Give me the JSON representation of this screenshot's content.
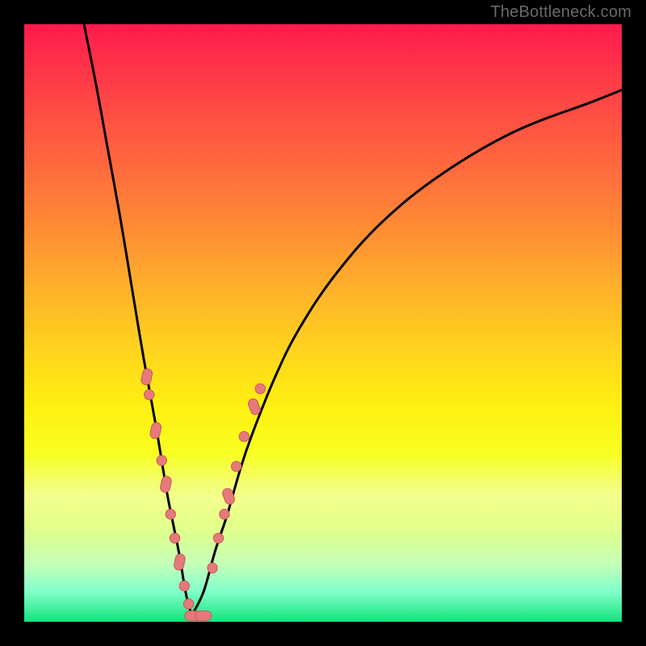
{
  "watermark": {
    "text": "TheBottleneck.com"
  },
  "colors": {
    "page_bg": "#000000",
    "curve_stroke": "#000000",
    "marker_fill": "#e67a7a",
    "marker_stroke": "#c85a5a"
  },
  "chart_data": {
    "type": "line",
    "title": "",
    "xlabel": "",
    "ylabel": "",
    "xlim": [
      0,
      100
    ],
    "ylim": [
      0,
      100
    ],
    "note": "Values are relative coordinates (percent of plot area). Two branches meet near bottom at x≈28.",
    "series": [
      {
        "name": "left-branch",
        "x": [
          10,
          12,
          14,
          16,
          18,
          20,
          22,
          23,
          24,
          25,
          26,
          27,
          28
        ],
        "y": [
          100,
          90,
          79,
          68,
          56,
          44,
          33,
          27,
          21,
          16,
          11,
          5,
          1
        ]
      },
      {
        "name": "right-branch",
        "x": [
          28,
          30,
          32,
          34,
          36,
          38,
          42,
          46,
          52,
          60,
          70,
          82,
          95,
          100
        ],
        "y": [
          1,
          5,
          12,
          18,
          25,
          31,
          41,
          49,
          58,
          67,
          75,
          82,
          87,
          89
        ]
      }
    ],
    "markers": [
      {
        "branch": "left-branch",
        "x": 20.5,
        "y": 41,
        "kind": "capsule"
      },
      {
        "branch": "left-branch",
        "x": 20.9,
        "y": 38,
        "kind": "dot"
      },
      {
        "branch": "left-branch",
        "x": 22.0,
        "y": 32,
        "kind": "capsule"
      },
      {
        "branch": "left-branch",
        "x": 23.0,
        "y": 27,
        "kind": "dot"
      },
      {
        "branch": "left-branch",
        "x": 23.7,
        "y": 23,
        "kind": "capsule"
      },
      {
        "branch": "left-branch",
        "x": 24.5,
        "y": 18,
        "kind": "dot"
      },
      {
        "branch": "left-branch",
        "x": 25.2,
        "y": 14,
        "kind": "dot"
      },
      {
        "branch": "left-branch",
        "x": 26.0,
        "y": 10,
        "kind": "capsule"
      },
      {
        "branch": "left-branch",
        "x": 26.8,
        "y": 6,
        "kind": "dot"
      },
      {
        "branch": "left-branch",
        "x": 27.5,
        "y": 3,
        "kind": "dot"
      },
      {
        "branch": "flat",
        "x": 28.2,
        "y": 1,
        "kind": "capsule-h"
      },
      {
        "branch": "flat",
        "x": 30.0,
        "y": 1,
        "kind": "capsule-h"
      },
      {
        "branch": "right-branch",
        "x": 31.5,
        "y": 9,
        "kind": "dot"
      },
      {
        "branch": "right-branch",
        "x": 32.5,
        "y": 14,
        "kind": "dot"
      },
      {
        "branch": "right-branch",
        "x": 33.5,
        "y": 18,
        "kind": "dot"
      },
      {
        "branch": "right-branch",
        "x": 34.2,
        "y": 21,
        "kind": "capsule"
      },
      {
        "branch": "right-branch",
        "x": 35.5,
        "y": 26,
        "kind": "dot"
      },
      {
        "branch": "right-branch",
        "x": 36.8,
        "y": 31,
        "kind": "dot"
      },
      {
        "branch": "right-branch",
        "x": 38.5,
        "y": 36,
        "kind": "capsule"
      },
      {
        "branch": "right-branch",
        "x": 39.5,
        "y": 39,
        "kind": "dot"
      }
    ]
  }
}
